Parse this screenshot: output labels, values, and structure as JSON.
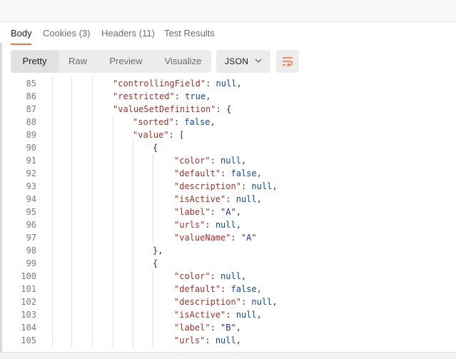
{
  "response_tabs": {
    "body": {
      "label": "Body"
    },
    "cookies": {
      "label": "Cookies",
      "count": "(3)"
    },
    "headers": {
      "label": "Headers",
      "count": "(11)"
    },
    "test_results": {
      "label": "Test Results"
    }
  },
  "view_modes": {
    "pretty": "Pretty",
    "raw": "Raw",
    "preview": "Preview",
    "visualize": "Visualize"
  },
  "format_dropdown": {
    "selected": "JSON"
  },
  "icons": {
    "dropdown": "chevron-down-icon",
    "wrap": "text-wrap-icon"
  },
  "accent_color": "#ff6c37",
  "code_lines": [
    {
      "n": "85",
      "indent": 1,
      "key": "controllingField",
      "val": "null",
      "vt": "b",
      "post": ","
    },
    {
      "n": "86",
      "indent": 1,
      "key": "restricted",
      "val": "true",
      "vt": "b",
      "post": ","
    },
    {
      "n": "87",
      "indent": 1,
      "key": "valueSetDefinition",
      "val": "{",
      "vt": "p",
      "post": ""
    },
    {
      "n": "88",
      "indent": 2,
      "key": "sorted",
      "val": "false",
      "vt": "b",
      "post": ","
    },
    {
      "n": "89",
      "indent": 2,
      "key": "value",
      "val": "[",
      "vt": "p",
      "post": ""
    },
    {
      "n": "90",
      "indent": 3,
      "raw": "{"
    },
    {
      "n": "91",
      "indent": 4,
      "key": "color",
      "val": "null",
      "vt": "b",
      "post": ","
    },
    {
      "n": "92",
      "indent": 4,
      "key": "default",
      "val": "false",
      "vt": "b",
      "post": ","
    },
    {
      "n": "93",
      "indent": 4,
      "key": "description",
      "val": "null",
      "vt": "b",
      "post": ","
    },
    {
      "n": "94",
      "indent": 4,
      "key": "isActive",
      "val": "null",
      "vt": "b",
      "post": ","
    },
    {
      "n": "95",
      "indent": 4,
      "key": "label",
      "val": "\"A\"",
      "vt": "s",
      "post": ","
    },
    {
      "n": "96",
      "indent": 4,
      "key": "urls",
      "val": "null",
      "vt": "b",
      "post": ","
    },
    {
      "n": "97",
      "indent": 4,
      "key": "valueName",
      "val": "\"A\"",
      "vt": "s",
      "post": ""
    },
    {
      "n": "98",
      "indent": 3,
      "raw": "},"
    },
    {
      "n": "99",
      "indent": 3,
      "raw": "{"
    },
    {
      "n": "100",
      "indent": 4,
      "key": "color",
      "val": "null",
      "vt": "b",
      "post": ","
    },
    {
      "n": "101",
      "indent": 4,
      "key": "default",
      "val": "false",
      "vt": "b",
      "post": ","
    },
    {
      "n": "102",
      "indent": 4,
      "key": "description",
      "val": "null",
      "vt": "b",
      "post": ","
    },
    {
      "n": "103",
      "indent": 4,
      "key": "isActive",
      "val": "null",
      "vt": "b",
      "post": ","
    },
    {
      "n": "104",
      "indent": 4,
      "key": "label",
      "val": "\"B\"",
      "vt": "s",
      "post": ","
    },
    {
      "n": "105",
      "indent": 4,
      "key": "urls",
      "val": "null",
      "vt": "b",
      "post": ","
    }
  ]
}
